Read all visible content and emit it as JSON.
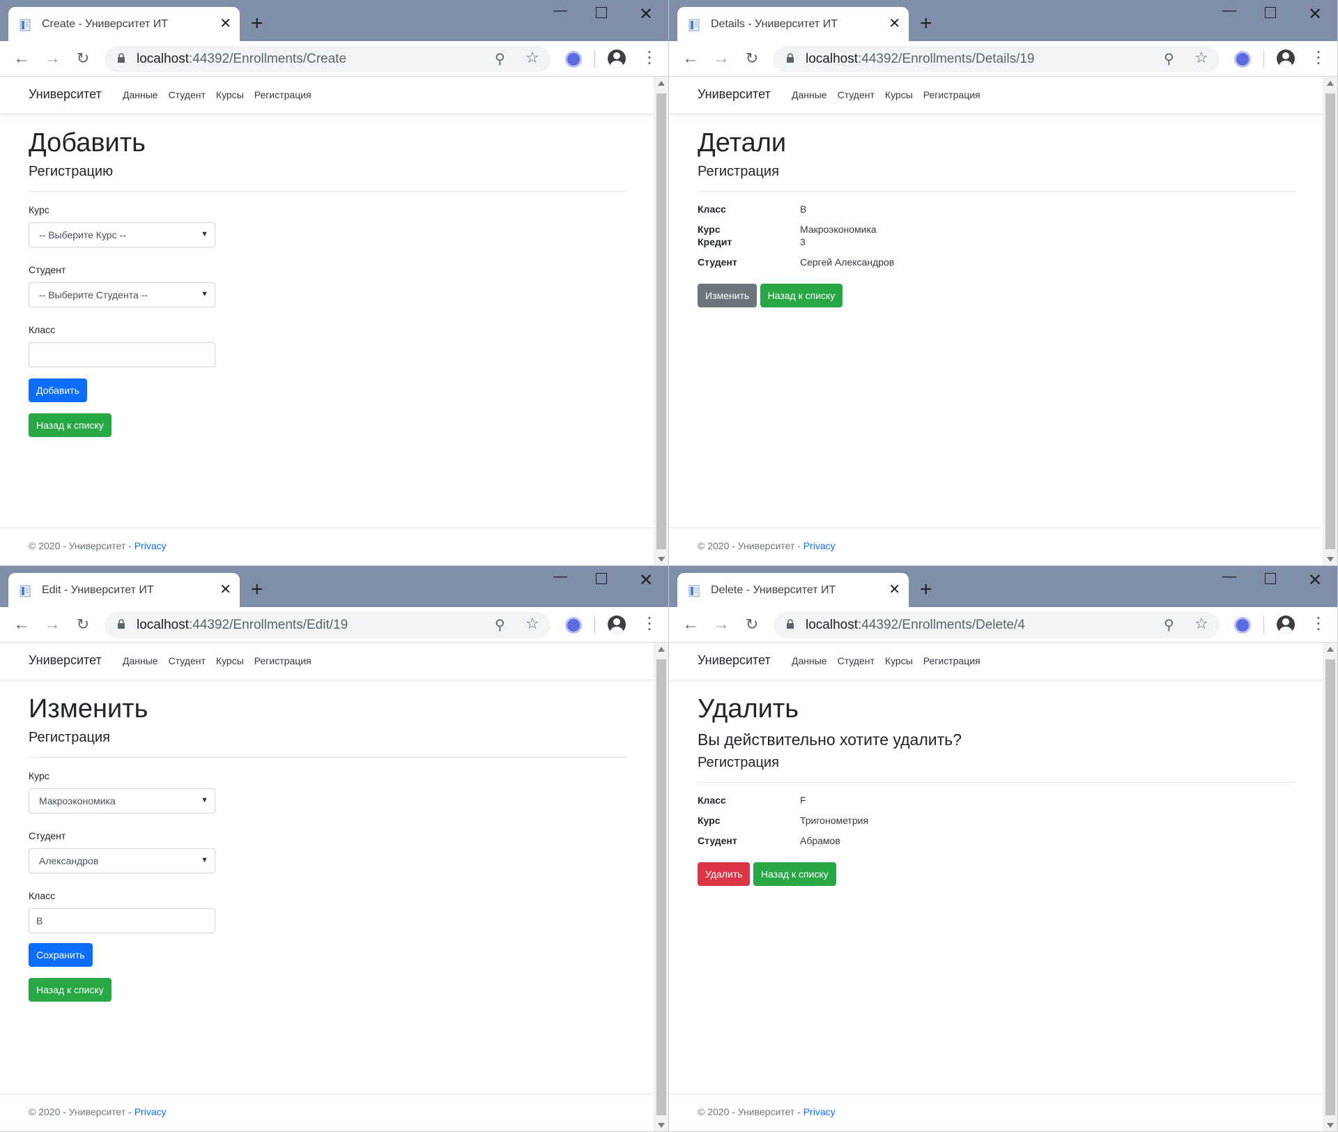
{
  "app": {
    "brand": "Университет",
    "nav": [
      "Данные",
      "Студент",
      "Курсы",
      "Регистрация"
    ],
    "footer_text": "© 2020 - Университет - ",
    "footer_link": "Privacy"
  },
  "windows": [
    {
      "tab_title": "Create - Университет ИТ",
      "url_host": "localhost",
      "url_rest": ":44392/Enrollments/Create",
      "heading": "Добавить",
      "subheading": "Регистрацию",
      "form": {
        "course_label": "Курс",
        "course_value": "-- Выберите Курс --",
        "student_label": "Студент",
        "student_value": "-- Выберите Студента --",
        "grade_label": "Класс",
        "grade_value": "",
        "submit": "Добавить",
        "back": "Назад к списку"
      }
    },
    {
      "tab_title": "Details - Университет ИТ",
      "url_host": "localhost",
      "url_rest": ":44392/Enrollments/Details/19",
      "heading": "Детали",
      "subheading": "Регистрация",
      "details": [
        {
          "term": "Класс",
          "value": "B"
        },
        {
          "term": "Курс",
          "value": "Макроэкономика"
        },
        {
          "term": "Кредит",
          "value": "3"
        },
        {
          "term": "Студент",
          "value": "Сергей Александров"
        }
      ],
      "edit": "Изменить",
      "back": "Назад к списку"
    },
    {
      "tab_title": "Edit - Университет ИТ",
      "url_host": "localhost",
      "url_rest": ":44392/Enrollments/Edit/19",
      "heading": "Изменить",
      "subheading": "Регистрация",
      "form": {
        "course_label": "Курс",
        "course_value": "Макроэкономика",
        "student_label": "Студент",
        "student_value": "Александров",
        "grade_label": "Класс",
        "grade_value": "B",
        "submit": "Сохранить",
        "back": "Назад к списку"
      }
    },
    {
      "tab_title": "Delete - Университет ИТ",
      "url_host": "localhost",
      "url_rest": ":44392/Enrollments/Delete/4",
      "heading": "Удалить",
      "question": "Вы действительно хотите удалить?",
      "subheading": "Регистрация",
      "details": [
        {
          "term": "Класс",
          "value": "F"
        },
        {
          "term": "Курс",
          "value": "Тригонометрия"
        },
        {
          "term": "Студент",
          "value": "Абрамов"
        }
      ],
      "delete": "Удалить",
      "back": "Назад к списку"
    }
  ],
  "colors": {
    "tabstrip": "#7f8fa8",
    "primary": "#0d6efd",
    "success": "#28a745",
    "secondary": "#6c757d",
    "danger": "#dc3545",
    "link": "#0d6efd"
  },
  "icons": {
    "back": "arrow-left-icon",
    "forward": "arrow-right-icon",
    "reload": "reload-icon",
    "lock": "lock-icon",
    "zoom": "zoom-icon",
    "star": "star-icon",
    "extension": "extension-icon",
    "profile": "profile-icon",
    "menu": "kebab-menu-icon",
    "favicon": "document-favicon-icon"
  }
}
